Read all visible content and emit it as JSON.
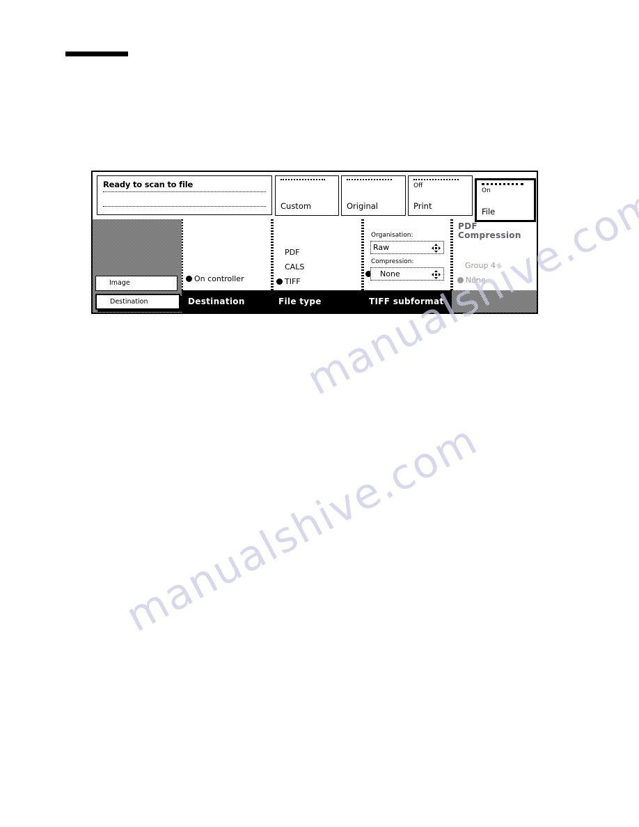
{
  "page": {
    "rule_present": true
  },
  "panel": {
    "status": {
      "title": "Ready to scan to file"
    },
    "top_tabs": [
      {
        "sub_label": "",
        "label": "Custom",
        "selected": false,
        "name": "tab-custom"
      },
      {
        "sub_label": "",
        "label": "Original",
        "selected": false,
        "name": "tab-original"
      },
      {
        "sub_label": "Off",
        "label": "Print",
        "selected": false,
        "name": "tab-print"
      },
      {
        "sub_label": "On",
        "label": "File",
        "selected": true,
        "name": "tab-file"
      }
    ],
    "sidebar": {
      "items": [
        {
          "label": "Image",
          "selected": false
        },
        {
          "label": "Destination",
          "selected": true
        }
      ]
    },
    "columns": [
      {
        "title": "Destination",
        "enabled": true,
        "options": [
          {
            "label": "On controller",
            "selected": true
          }
        ]
      },
      {
        "title": "File type",
        "enabled": true,
        "options": [
          {
            "label": "PDF",
            "selected": false
          },
          {
            "label": "CALS",
            "selected": false
          },
          {
            "label": "TIFF",
            "selected": true
          }
        ]
      },
      {
        "title": "TIFF subformat",
        "enabled": true,
        "fields": [
          {
            "label": "Organisation:",
            "value": "Raw",
            "spinner": true
          },
          {
            "label": "Compression:",
            "value": "None",
            "spinner": true,
            "selected": true
          }
        ]
      },
      {
        "title": "PDF Compression",
        "enabled": false,
        "options": [
          {
            "label": "Group 4",
            "selected": false
          },
          {
            "label": "None",
            "selected": true
          }
        ]
      }
    ]
  },
  "watermark": {
    "line1": "manualshive.com",
    "line2": "manualshive.com"
  },
  "colors": {
    "ink": "#000000",
    "paper": "#ffffff",
    "disabled_text": "#9a9a9a",
    "watermark": "#c9c9e8"
  }
}
